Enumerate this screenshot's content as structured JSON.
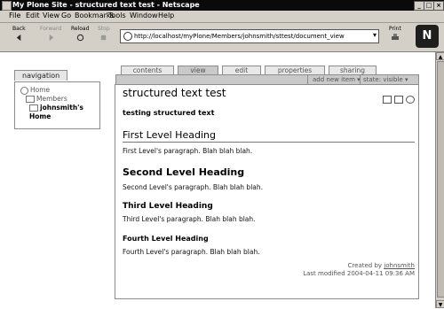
{
  "window": {
    "title": "My Plone Site - structured text test - Netscape",
    "controls": [
      "_",
      "□",
      "×"
    ]
  },
  "menubar": [
    "File",
    "Edit",
    "View",
    "Go",
    "Bookmarks",
    "Tools",
    "Window",
    "Help"
  ],
  "toolbar": {
    "back": "Back",
    "forward": "Forward",
    "reload": "Reload",
    "stop": "Stop",
    "print": "Print",
    "url": "http://localhost/myPlone/Members/johnsmith/sttest/document_view",
    "throbber": "N"
  },
  "navigation": {
    "tab": "navigation",
    "items": [
      "Home",
      "Members",
      "johnsmith's Home"
    ]
  },
  "tabs": [
    "contents",
    "view",
    "edit",
    "properties",
    "sharing"
  ],
  "active_tab": "view",
  "actions": {
    "add_new": "add new item",
    "state": "state: visible"
  },
  "document": {
    "title": "structured text test",
    "description": "testing structured text",
    "h1": "First Level Heading",
    "p1": "First Level's paragraph. Blah blah blah.",
    "h2": "Second Level Heading",
    "p2": "Second Level's paragraph. Blah blah blah.",
    "h3": "Third Level Heading",
    "p3": "Third Level's paragraph. Blah blah blah.",
    "h4": "Fourth Level Heading",
    "p4": "Fourth Level's paragraph. Blah blah blah."
  },
  "footer": {
    "created_by": "Created by",
    "author": "johnsmith",
    "last_modified": "Last modified 2004-04-11 09:36 AM"
  }
}
